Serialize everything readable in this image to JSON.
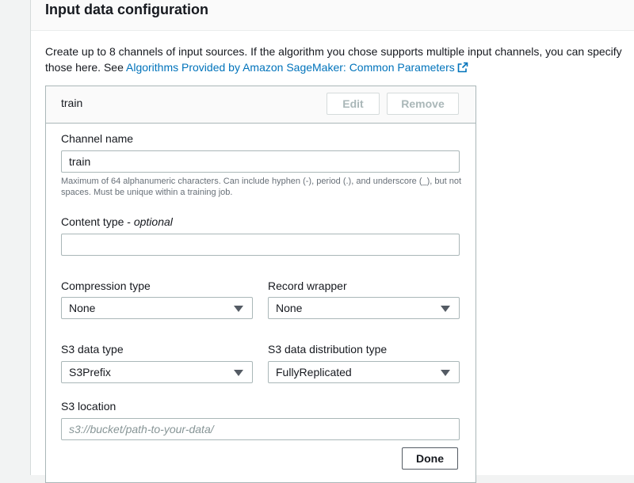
{
  "panel": {
    "title": "Input data configuration",
    "description_text": "Create up to 8 channels of input sources. If the algorithm you chose supports multiple input channels, you can specify those here.",
    "see_text": "See",
    "doc_link": "Algorithms Provided by Amazon SageMaker: Common Parameters",
    "doc_link_icon": "external-link-icon"
  },
  "channel": {
    "title": "train",
    "edit_label": "Edit",
    "remove_label": "Remove",
    "done_label": "Done",
    "channel_name": {
      "label": "Channel name",
      "value": "train",
      "hint": "Maximum of 64 alphanumeric characters. Can include hyphen (-), period (.), and underscore (_), but not spaces. Must be unique within a training job."
    },
    "content_type": {
      "label": "Content type",
      "optional": "optional",
      "value": ""
    },
    "compression_type": {
      "label": "Compression type",
      "value": "None"
    },
    "record_wrapper": {
      "label": "Record wrapper",
      "value": "None"
    },
    "s3_data_type": {
      "label": "S3 data type",
      "value": "S3Prefix"
    },
    "s3_distribution": {
      "label": "S3 data distribution type",
      "value": "FullyReplicated"
    },
    "s3_location": {
      "label": "S3 location",
      "placeholder": "s3://bucket/path-to-your-data/"
    }
  },
  "colors": {
    "link": "#0073bb",
    "border": "#aab7b8",
    "disabled_text": "#aab7b8",
    "hint_text": "#687078"
  }
}
